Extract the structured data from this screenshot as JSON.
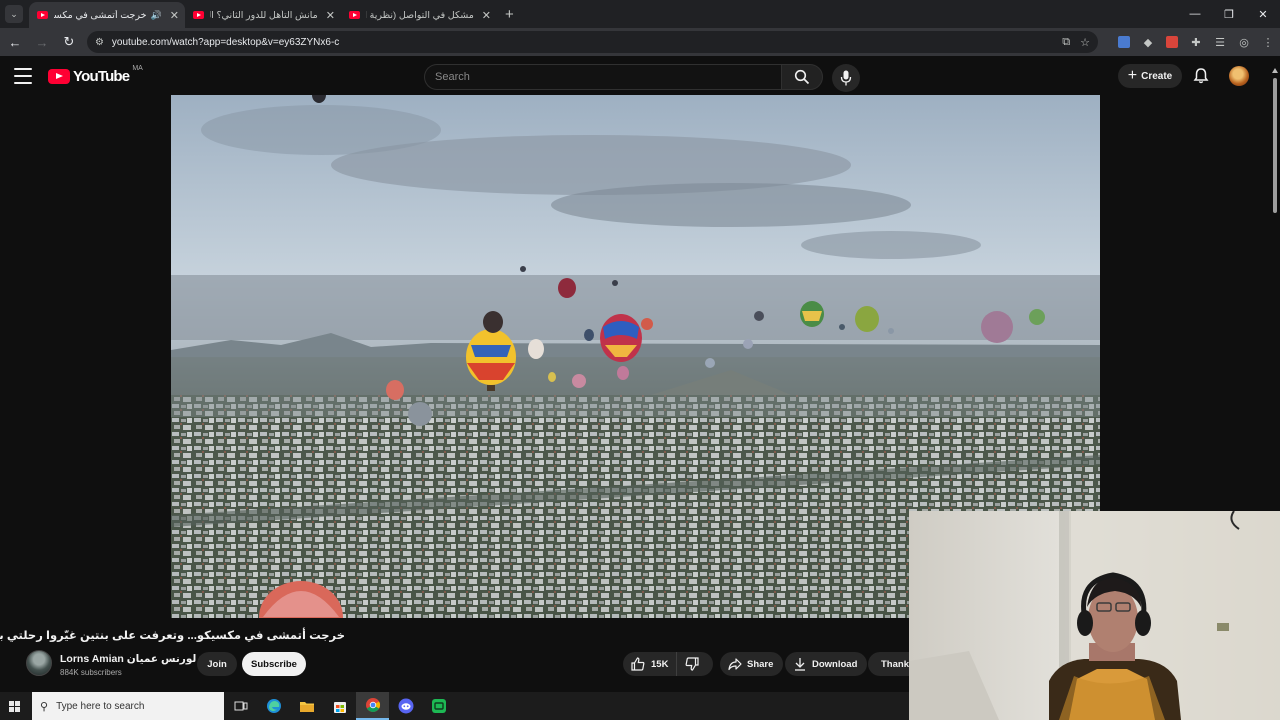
{
  "browser": {
    "tabs": [
      {
        "title": "خرجت أتمشى في مكسيكو...",
        "active": true,
        "playing_audio": true
      },
      {
        "title": "مانش التأهل للدور الثاني؟ التشكـ",
        "active": false
      },
      {
        "title": "مشكل في التواصل (نظرية البراك...",
        "active": false
      }
    ],
    "url": "youtube.com/watch?app=desktop&v=ey63ZYNx6-c"
  },
  "youtube": {
    "logo_text": "YouTube",
    "country_code": "MA",
    "search_placeholder": "Search",
    "create_label": "Create"
  },
  "video": {
    "title": "خرجت أتمشى في مكسيكو... وتعرفت على بنتين غيّروا رحلتي بالكامل MX",
    "channel_name": "Lorns Amian لورنس عميان",
    "subscribers": "884K subscribers",
    "join_label": "Join",
    "subscribe_label": "Subscribe",
    "likes": "15K",
    "share_label": "Share",
    "download_label": "Download",
    "thanks_label": "Thanks"
  },
  "taskbar": {
    "search_placeholder": "Type here to search"
  },
  "colors": {
    "youtube_red": "#ff0033",
    "background": "#0f0f0f",
    "chip": "#272727"
  }
}
